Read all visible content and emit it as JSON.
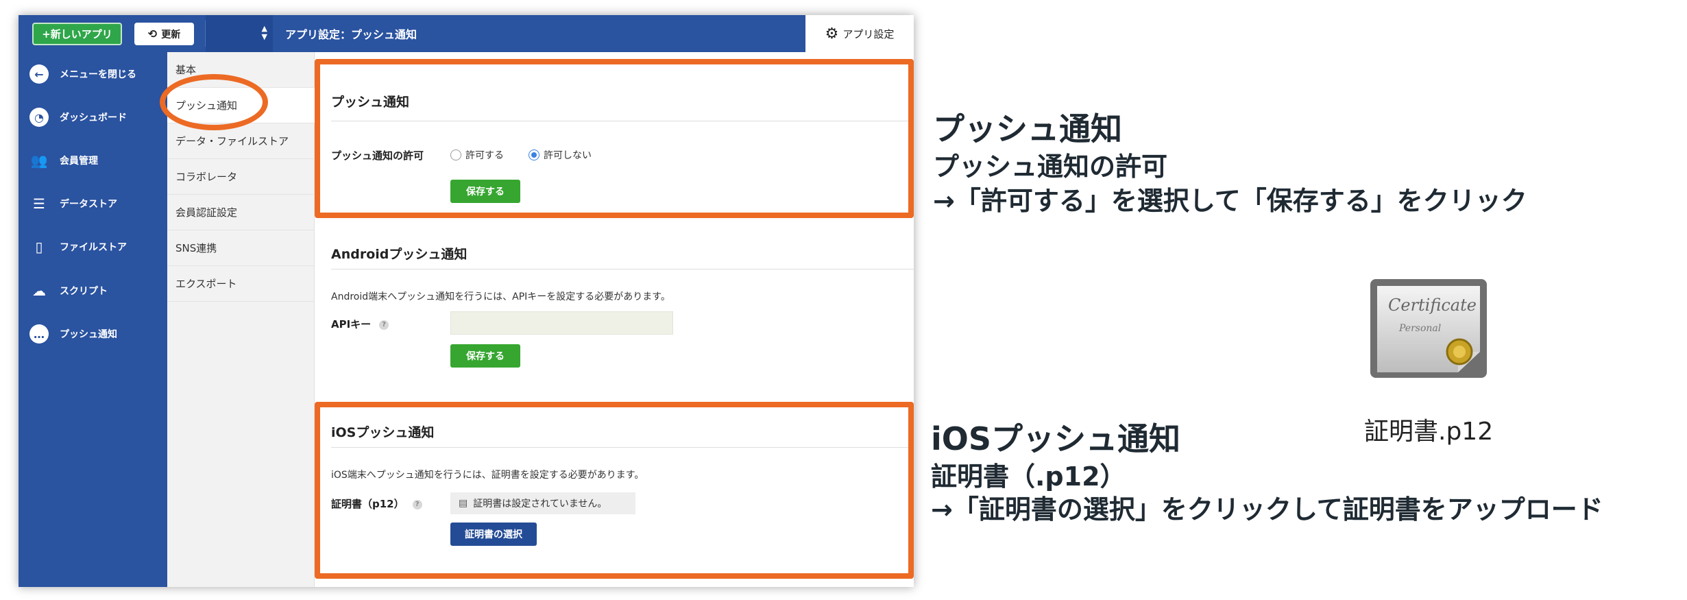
{
  "topbar": {
    "new_app": "+新しいアプリ",
    "refresh": "更新",
    "refresh_icon": "refresh-icon",
    "breadcrumb": "アプリ設定：プッシュ通知",
    "app_settings": "アプリ設定",
    "app_settings_icon": "gear-icon"
  },
  "leftnav": {
    "items": [
      {
        "label": "メニューを閉じる",
        "icon": "arrow-left-icon"
      },
      {
        "label": "ダッシュボード",
        "icon": "gauge-icon"
      },
      {
        "label": "会員管理",
        "icon": "users-icon"
      },
      {
        "label": "データストア",
        "icon": "database-icon"
      },
      {
        "label": "ファイルストア",
        "icon": "file-icon"
      },
      {
        "label": "スクリプト",
        "icon": "cloud-gear-icon"
      },
      {
        "label": "プッシュ通知",
        "icon": "chat-bubble-icon"
      }
    ]
  },
  "subnav": {
    "items": [
      {
        "label": "基本"
      },
      {
        "label": "プッシュ通知",
        "active": true
      },
      {
        "label": "データ・ファイルストア"
      },
      {
        "label": "コラボレータ"
      },
      {
        "label": "会員認証設定"
      },
      {
        "label": "SNS連携"
      },
      {
        "label": "エクスポート"
      }
    ]
  },
  "push": {
    "title": "プッシュ通知",
    "permission_label": "プッシュ通知の許可",
    "allow": "許可する",
    "deny": "許可しない",
    "selected": "deny",
    "save": "保存する"
  },
  "android": {
    "title": "Androidプッシュ通知",
    "description": "Android端末へプッシュ通知を行うには、APIキーを設定する必要があります。",
    "api_key_label": "APIキー",
    "api_key_value": "",
    "save": "保存する"
  },
  "ios": {
    "title": "iOSプッシュ通知",
    "description": "iOS端末へプッシュ通知を行うには、証明書を設定する必要があります。",
    "cert_label": "証明書（p12）",
    "cert_status": "証明書は設定されていません。",
    "select_cert": "証明書の選択"
  },
  "annotations": {
    "push_heading": "プッシュ通知",
    "push_sub": "プッシュ通知の許可",
    "push_instruction": "→「許可する」を選択して「保存する」をクリック",
    "ios_heading": "iOSプッシュ通知",
    "ios_sub": "証明書（.p12）",
    "ios_instruction": "→「証明書の選択」をクリックして証明書をアップロード",
    "cert_filename": "証明書.p12",
    "cert_badge_line1": "Certificate",
    "cert_badge_line2": "Personal"
  },
  "colors": {
    "nav_blue": "#2a53a0",
    "accent_orange": "#ec6a24",
    "save_green": "#36a630",
    "button_blue": "#244c96"
  }
}
